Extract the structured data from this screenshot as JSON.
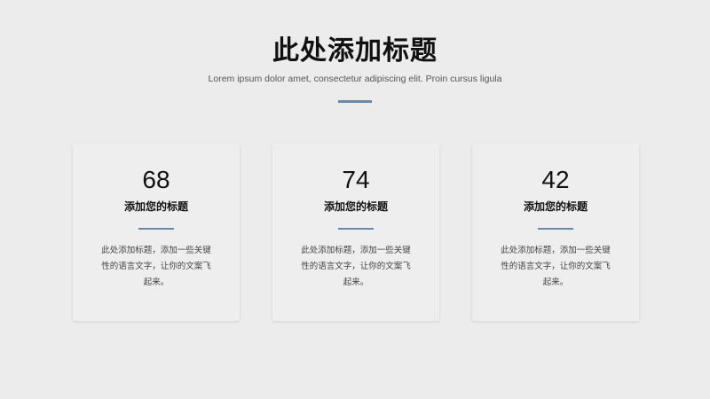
{
  "header": {
    "title": "此处添加标题",
    "subtitle": "Lorem ipsum dolor amet, consectetur adipiscing elit. Proin cursus ligula",
    "accent_color": "#5b8db8"
  },
  "cards": [
    {
      "number": "68",
      "title": "添加您的标题",
      "body": "此处添加标题，添加一些关键性的语言文字，让你的文案飞起来。"
    },
    {
      "number": "74",
      "title": "添加您的标题",
      "body": "此处添加标题，添加一些关键性的语言文字，让你的文案飞起来。"
    },
    {
      "number": "42",
      "title": "添加您的标题",
      "body": "此处添加标题，添加一些关键性的语言文字，让你的文案飞起来。"
    }
  ]
}
